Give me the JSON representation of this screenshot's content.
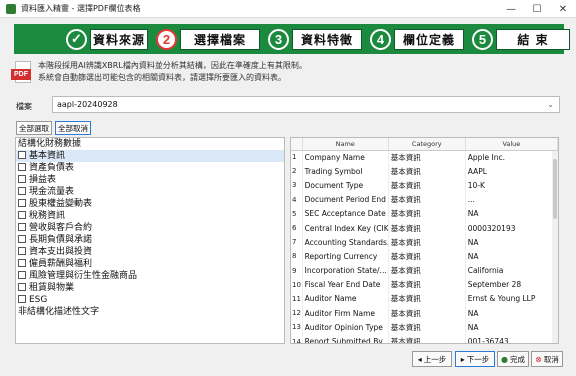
{
  "window": {
    "title": "資料匯入精靈 - 選擇PDF欄位表格",
    "minimize": "—",
    "maximize": "☐",
    "close": "✕"
  },
  "steps": [
    {
      "num": "✓",
      "label": "資料來源",
      "state": "done"
    },
    {
      "num": "2",
      "label": "選擇檔案",
      "state": "active"
    },
    {
      "num": "3",
      "label": "資料特徵",
      "state": "pending"
    },
    {
      "num": "4",
      "label": "欄位定義",
      "state": "pending"
    },
    {
      "num": "5",
      "label": "結 束",
      "state": "pending"
    }
  ],
  "pdf_icon_text": "PDF",
  "description": {
    "line1": "本階段採用AI辨識XBRL檔內資料並分析其結構，因此在準確度上有其限制。",
    "line2": "系統會自動篩選出可能包含的相關資料表，請選擇所要匯入的資料表。"
  },
  "file": {
    "label": "檔案",
    "value": "aapl-20240928"
  },
  "buttons": {
    "select_all": "全部選取",
    "deselect_all": "全部取消",
    "prev": "上一步",
    "next": "下一步",
    "finish": "完成",
    "cancel": "取消"
  },
  "tree": {
    "root": "結構化財務數據",
    "items": [
      "基本資訊",
      "資產負債表",
      "損益表",
      "現金流量表",
      "股東權益變動表",
      "稅務資訊",
      "營收與客戶合約",
      "長期負債與承諾",
      "資本支出與投資",
      "僱員薪酬與福利",
      "風險管理與衍生性金融商品",
      "租賃與物業",
      "ESG"
    ],
    "footer": "非結構化描述性文字"
  },
  "table": {
    "headers": [
      "",
      "Name",
      "Category",
      "Value"
    ],
    "rows": [
      [
        "1",
        "Company Name",
        "基本資訊",
        "Apple Inc."
      ],
      [
        "2",
        "Trading Symbol",
        "基本資訊",
        "AAPL"
      ],
      [
        "3",
        "Document Type",
        "基本資訊",
        "10-K"
      ],
      [
        "4",
        "Document Period End ...",
        "基本資訊",
        "..."
      ],
      [
        "5",
        "SEC Acceptance Date",
        "基本資訊",
        "NA"
      ],
      [
        "6",
        "Central Index Key (CIK)",
        "基本資訊",
        "0000320193"
      ],
      [
        "7",
        "Accounting Standards...",
        "基本資訊",
        "NA"
      ],
      [
        "8",
        "Reporting Currency",
        "基本資訊",
        "NA"
      ],
      [
        "9",
        "Incorporation State/...",
        "基本資訊",
        "California"
      ],
      [
        "10",
        "Fiscal Year End Date",
        "基本資訊",
        "September 28"
      ],
      [
        "11",
        "Auditor Name",
        "基本資訊",
        "Ernst & Young LLP"
      ],
      [
        "12",
        "Auditor Firm Name",
        "基本資訊",
        "NA"
      ],
      [
        "13",
        "Auditor Opinion Type",
        "基本資訊",
        "NA"
      ],
      [
        "14",
        "Report Submitted By",
        "基本資訊",
        "001-36743"
      ]
    ]
  },
  "colors": {
    "step_bar": "#1b8a3e",
    "active_step": "#e53935",
    "selection": "#dbe8f8"
  }
}
